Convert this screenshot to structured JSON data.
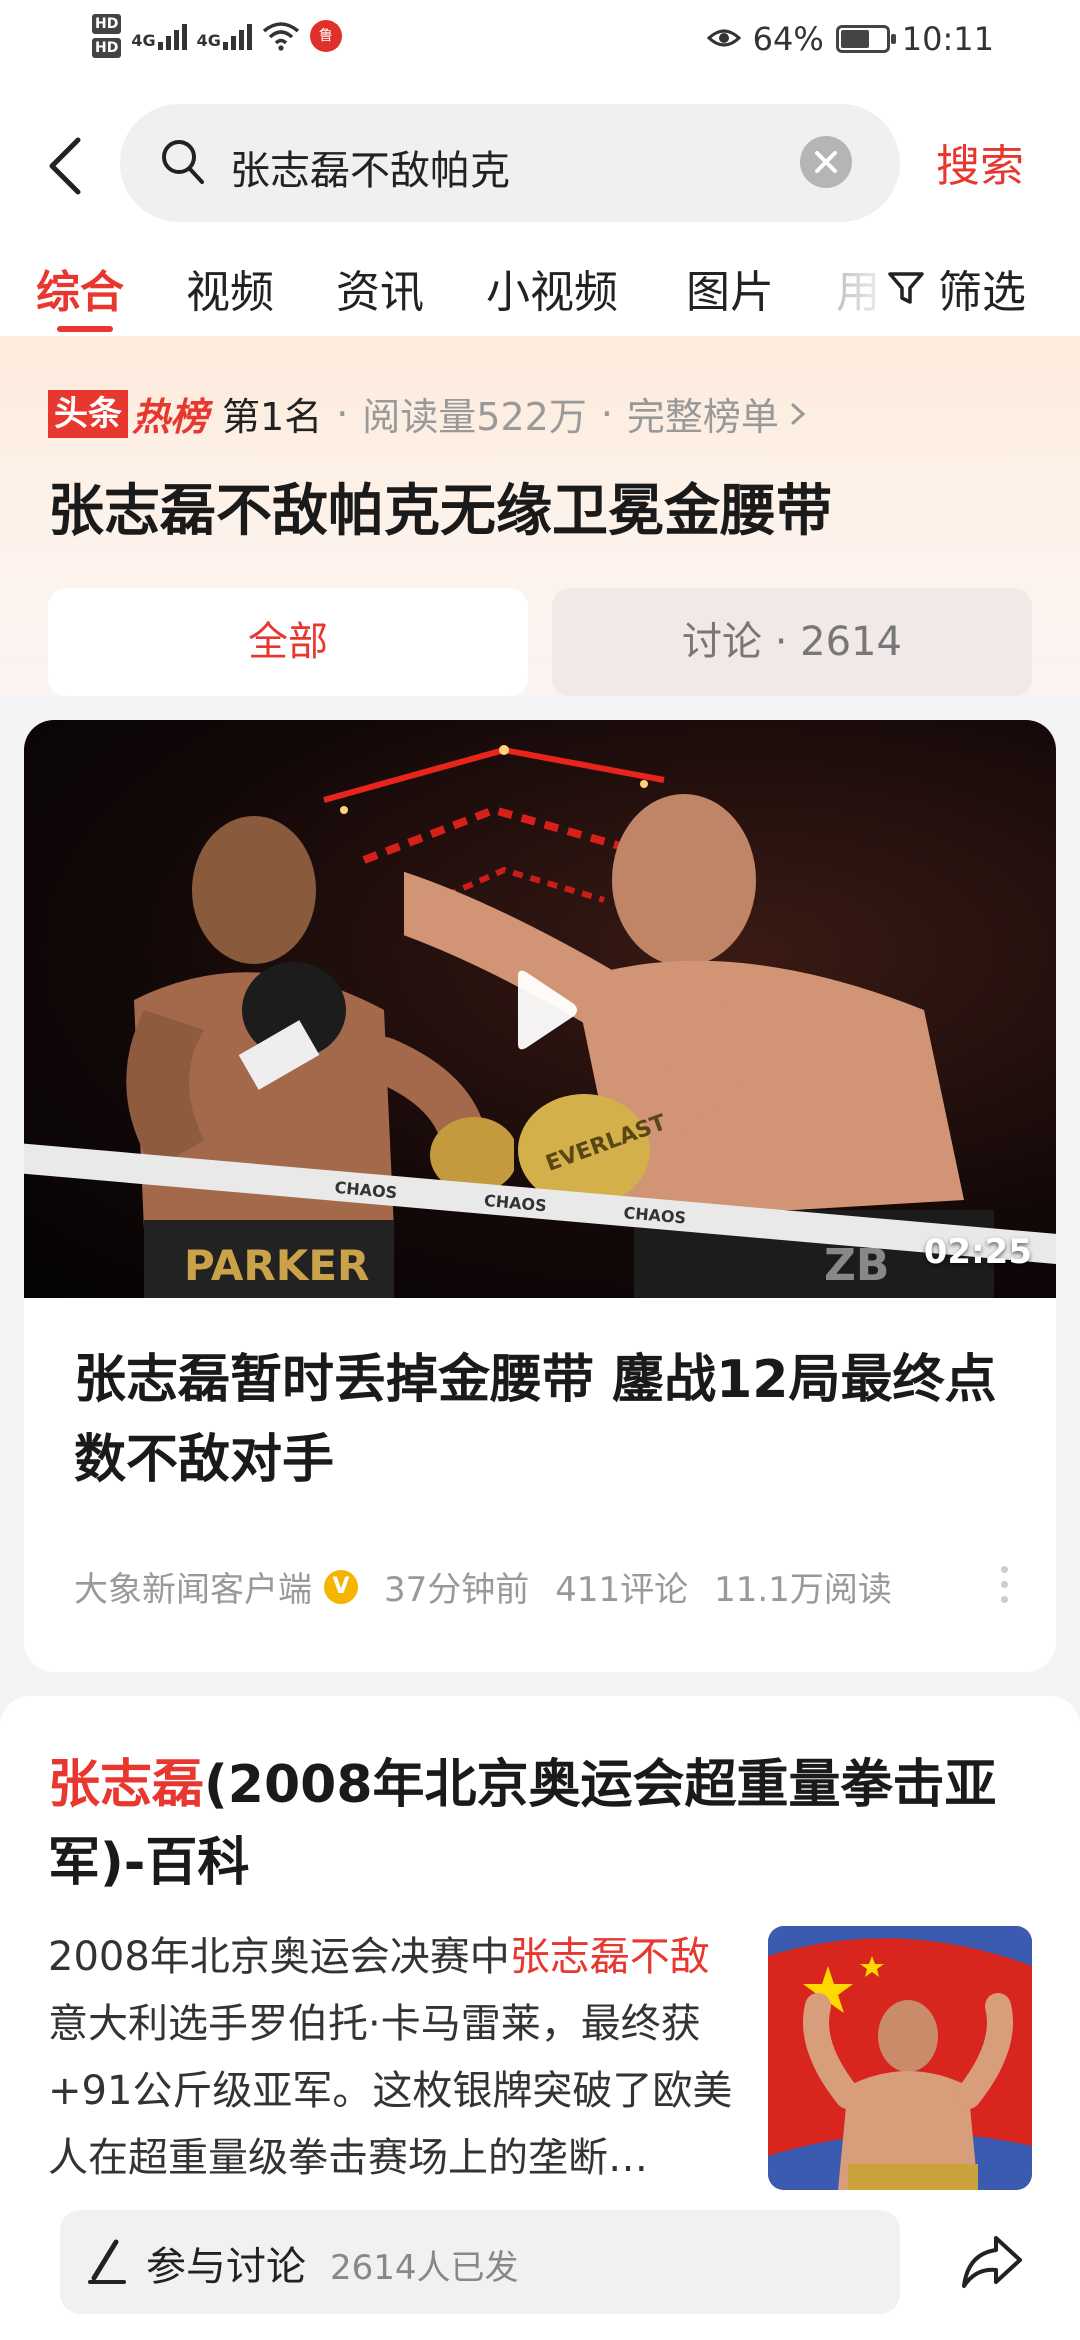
{
  "status_bar": {
    "hd1": "HD",
    "hd2": "HD",
    "net1": "4G",
    "net2": "4G",
    "app_badge": "鲁",
    "battery_percent": "64%",
    "battery_level": 0.64,
    "time": "10:11"
  },
  "search": {
    "query": "张志磊不敌帕克",
    "button_label": "搜索"
  },
  "tabs": {
    "items": [
      "综合",
      "视频",
      "资讯",
      "小视频",
      "图片",
      "用"
    ],
    "active_index": 0,
    "filter_label": "筛选"
  },
  "hot_list": {
    "brand_part1": "头条",
    "brand_part2": "热榜",
    "rank": "第1名",
    "reads": "阅读量522万",
    "full_list": "完整榜单",
    "sep": "·",
    "title": "张志磊不敌帕克无缘卫冕金腰带",
    "segment_all": "全部",
    "segment_discuss": "讨论 · 2614"
  },
  "video_card": {
    "duration": "02:25",
    "title": "张志磊暂时丢掉金腰带 鏖战12局最终点数不敌对手",
    "source": "大象新闻客户端",
    "time_ago": "37分钟前",
    "comments": "411评论",
    "reads": "11.1万阅读",
    "rope_text": "CHAOS",
    "shorts_left": "PARKER",
    "glove_text": "EVERLAST",
    "shorts_right": "ZB"
  },
  "baike_card": {
    "title_highlight": "张志磊",
    "title_rest": "(2008年北京奥运会超重量拳击亚军)-百科",
    "desc_pre": "2008年北京奥运会决赛中",
    "desc_highlight": "张志磊不敌",
    "desc_post": "意大利选手罗伯托·卡马雷莱，最终获+91公斤级亚军。这枚银牌突破了欧美人在超重量级拳击赛场上的垄断…"
  },
  "discuss_bar": {
    "label": "参与讨论",
    "count": "2614人已发"
  },
  "colors": {
    "accent": "#e8372f",
    "meta_gray": "#999999",
    "verified": "#f5b400"
  }
}
